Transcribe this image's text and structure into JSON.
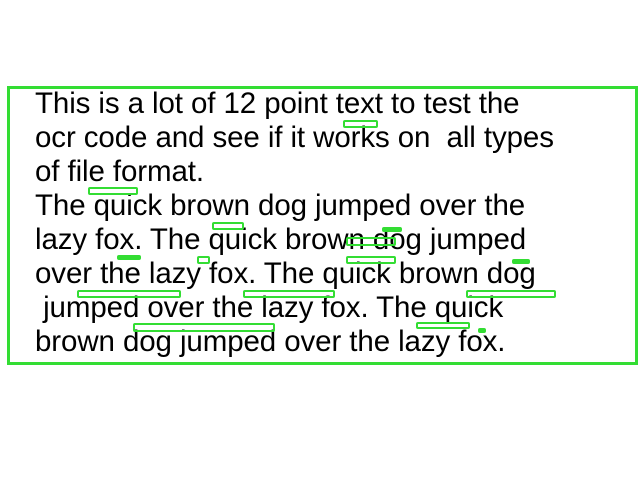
{
  "document": {
    "lines": [
      "This is a lot of 12 point text to test the",
      "ocr code and see if it works on  all types",
      "of file format.",
      "The quick brown dog jumped over the",
      "lazy fox. The quick brown dog jumped",
      "over the lazy fox. The quick brown dog",
      " jumped over the lazy fox. The quick",
      "brown dog jumped over the lazy fox."
    ]
  },
  "colors": {
    "highlight": "#33dd33",
    "text": "#000000",
    "background": "#ffffff"
  }
}
